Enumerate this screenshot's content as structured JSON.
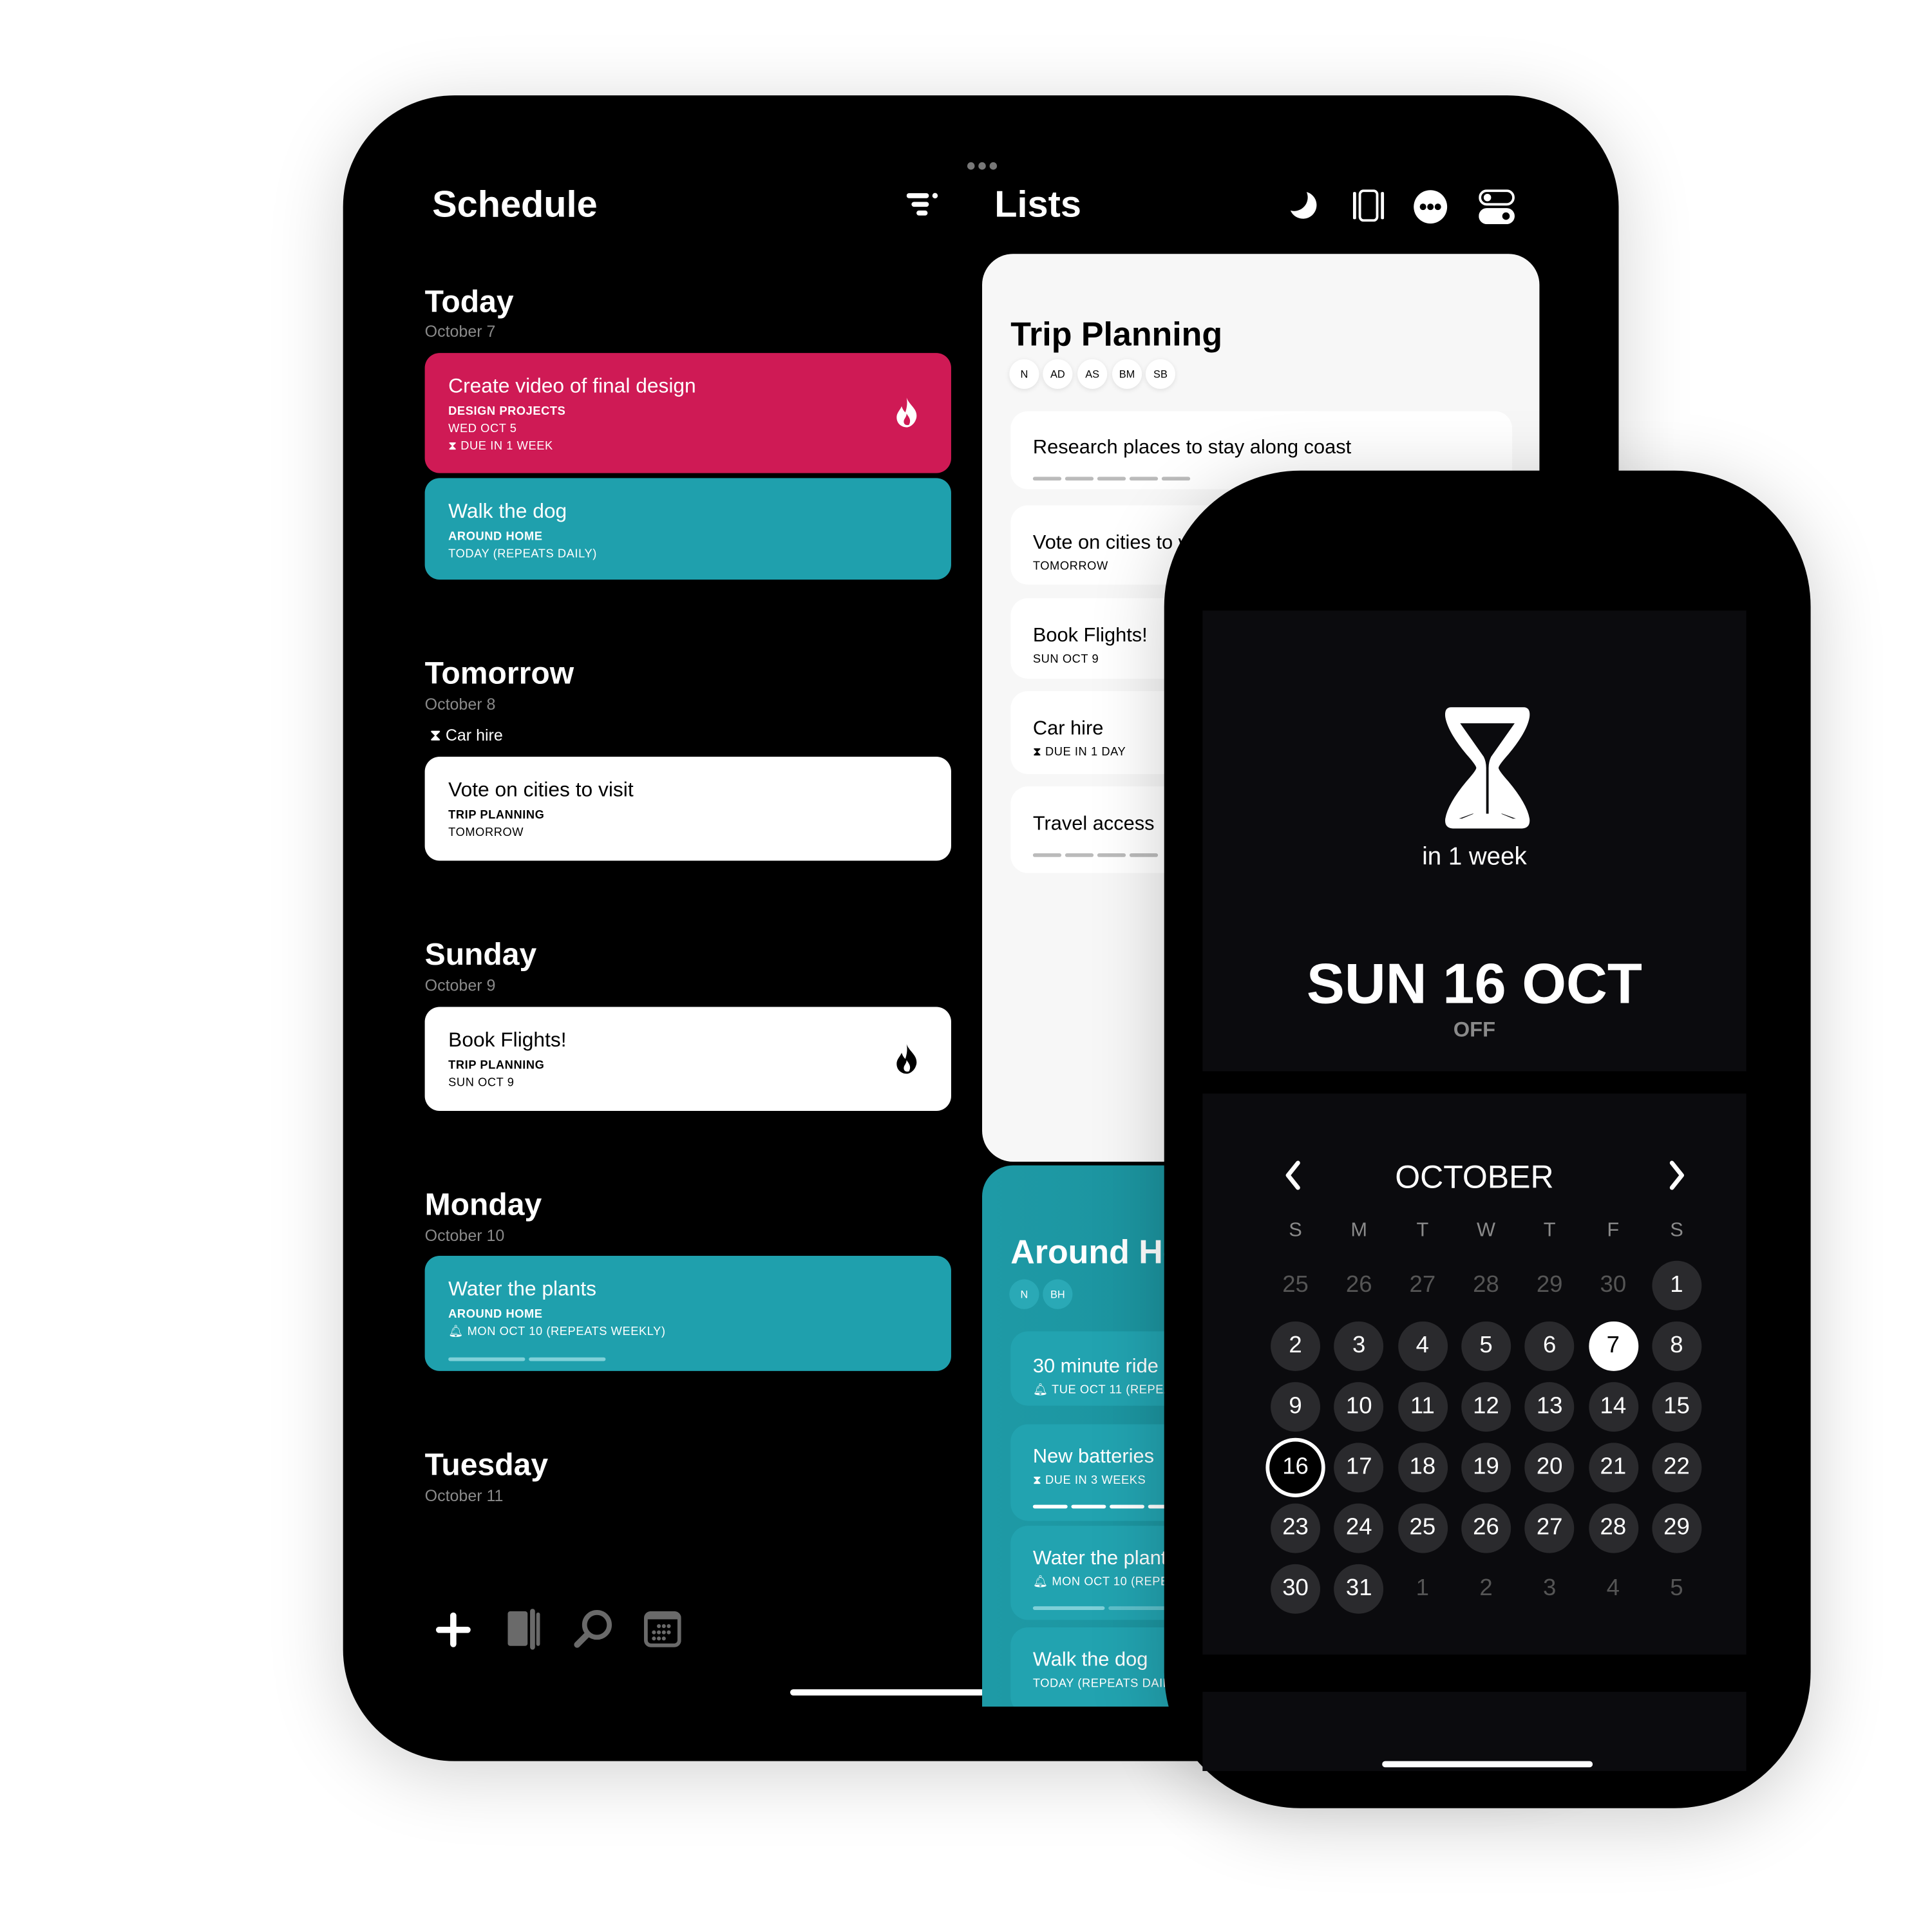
{
  "schedule": {
    "title": "Schedule",
    "sections": [
      {
        "day": "Today",
        "date": "October 7"
      },
      {
        "day": "Tomorrow",
        "date": "October 8",
        "note": "Car hire"
      },
      {
        "day": "Sunday",
        "date": "October 9"
      },
      {
        "day": "Monday",
        "date": "October 10"
      },
      {
        "day": "Tuesday",
        "date": "October 11"
      }
    ],
    "tasks": [
      {
        "title": "Create video of final design",
        "list": "DESIGN PROJECTS",
        "date": "WED OCT 5",
        "due": "DUE IN 1 WEEK",
        "color": "#cf1a55",
        "flag": "flame-icon"
      },
      {
        "title": "Walk the dog",
        "list": "AROUND HOME",
        "date": "TODAY (REPEATS DAILY)",
        "color": "#1fa0ad"
      },
      {
        "title": "Vote on cities to visit",
        "list": "TRIP PLANNING",
        "date": "TOMORROW",
        "color": "#ffffff"
      },
      {
        "title": "Book Flights!",
        "list": "TRIP PLANNING",
        "date": "SUN OCT 9",
        "color": "#ffffff",
        "flag": "flame-icon"
      },
      {
        "title": "Water the plants",
        "list": "AROUND HOME",
        "date": "MON OCT 10 (REPEATS WEEKLY)",
        "color": "#1fa0ad",
        "progress": 0.33
      }
    ],
    "toolbar": [
      "plus-icon",
      "book-icon",
      "search-icon",
      "calendar-icon"
    ]
  },
  "lists": {
    "title": "Lists",
    "header_icons": [
      "moon-icon",
      "sidebar-icon",
      "more-icon",
      "toggles-icon"
    ],
    "trip": {
      "title": "Trip Planning",
      "members": [
        "N",
        "AD",
        "AS",
        "BM",
        "SB"
      ],
      "items": [
        {
          "title": "Research places to stay along coast",
          "sub": ""
        },
        {
          "title": "Vote on cities to visit",
          "sub": "TOMORROW"
        },
        {
          "title": "Book Flights!",
          "sub": "SUN OCT 9"
        },
        {
          "title": "Car hire",
          "sub": "DUE IN 1 DAY"
        },
        {
          "title": "Travel access",
          "sub": ""
        }
      ]
    },
    "home": {
      "title": "Around Home",
      "members": [
        "N",
        "BH"
      ],
      "items": [
        {
          "title": "30 minute ride",
          "sub": "TUE OCT 11 (REPEAT"
        },
        {
          "title": "New batteries",
          "sub": "DUE IN 3 WEEKS"
        },
        {
          "title": "Water the plants",
          "sub": "MON OCT 10 (REPEA"
        },
        {
          "title": "Walk the dog",
          "sub": "TODAY (REPEATS DAILY"
        }
      ]
    }
  },
  "phone": {
    "countdown": "in 1 week",
    "date": "SUN 16 OCT",
    "status": "OFF",
    "month": "OCTOBER",
    "weekdays": [
      "S",
      "M",
      "T",
      "W",
      "T",
      "F",
      "S"
    ],
    "prev_month_days": [
      25,
      26,
      27,
      28,
      29,
      30
    ],
    "days_in_month": 31,
    "next_month_days": [
      1,
      2,
      3,
      4,
      5
    ],
    "today": 7,
    "selected": 16
  }
}
